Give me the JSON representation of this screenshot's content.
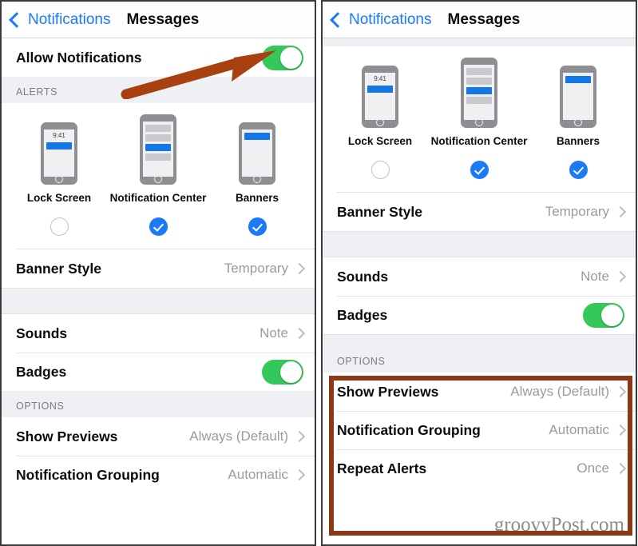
{
  "nav": {
    "back_label": "Notifications",
    "title": "Messages",
    "back_icon": "chevron-left-icon",
    "accent_color": "#1a7af8"
  },
  "annotation": {
    "arrow_color": "#a8400f",
    "highlight_color": "#8a3a16"
  },
  "watermark": "groovyPost.com",
  "sections": {
    "alerts_header": "ALERTS",
    "options_header": "OPTIONS"
  },
  "left_panel": {
    "allow_row": {
      "label": "Allow Notifications",
      "toggle_state": "on",
      "toggle_color": "#34c759"
    },
    "alert_styles": [
      {
        "label": "Lock Screen",
        "icon": "lock-screen-phone-icon",
        "time": "9:41",
        "selected": false
      },
      {
        "label": "Notification Center",
        "icon": "notification-center-phone-icon",
        "selected": true
      },
      {
        "label": "Banners",
        "icon": "banners-phone-icon",
        "selected": true
      }
    ],
    "rows": [
      {
        "label": "Banner Style",
        "value": "Temporary",
        "type": "disclosure"
      },
      {
        "label": "Sounds",
        "value": "Note",
        "type": "disclosure"
      },
      {
        "label": "Badges",
        "value": "",
        "type": "toggle",
        "toggle_state": "on"
      },
      {
        "label": "Show Previews",
        "value": "Always (Default)",
        "type": "disclosure"
      },
      {
        "label": "Notification Grouping",
        "value": "Automatic",
        "type": "disclosure"
      }
    ]
  },
  "right_panel": {
    "alert_styles": [
      {
        "label": "Lock Screen",
        "icon": "lock-screen-phone-icon",
        "time": "9:41",
        "selected": false
      },
      {
        "label": "Notification Center",
        "icon": "notification-center-phone-icon",
        "selected": true
      },
      {
        "label": "Banners",
        "icon": "banners-phone-icon",
        "selected": true
      }
    ],
    "rows": [
      {
        "label": "Banner Style",
        "value": "Temporary",
        "type": "disclosure"
      },
      {
        "label": "Sounds",
        "value": "Note",
        "type": "disclosure"
      },
      {
        "label": "Badges",
        "value": "",
        "type": "toggle",
        "toggle_state": "on"
      }
    ],
    "option_rows": [
      {
        "label": "Show Previews",
        "value": "Always (Default)",
        "type": "disclosure"
      },
      {
        "label": "Notification Grouping",
        "value": "Automatic",
        "type": "disclosure"
      },
      {
        "label": "Repeat Alerts",
        "value": "Once",
        "type": "disclosure"
      }
    ]
  }
}
